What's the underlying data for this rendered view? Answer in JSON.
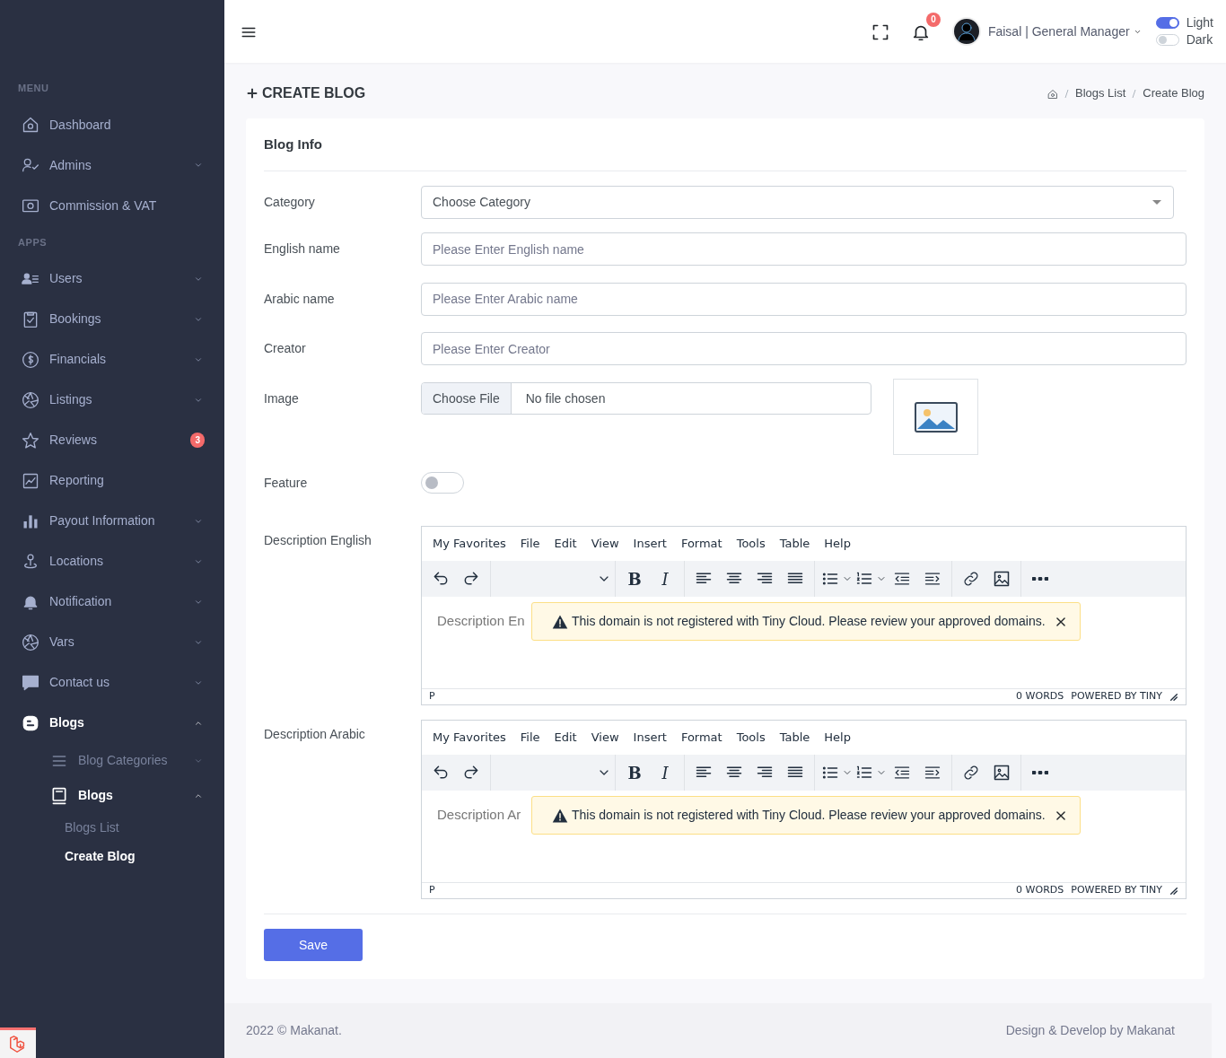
{
  "sidebar": {
    "sections": [
      {
        "title": "MENU",
        "items": [
          {
            "label": "Dashboard",
            "kind": "link",
            "selected": false
          },
          {
            "label": "Admins",
            "kind": "dropdown",
            "expanded": false,
            "selected": false
          },
          {
            "label": "Commission & VAT",
            "kind": "link",
            "selected": false
          }
        ]
      },
      {
        "title": "APPS",
        "items": [
          {
            "label": "Users",
            "kind": "dropdown",
            "expanded": false,
            "selected": false
          },
          {
            "label": "Bookings",
            "kind": "dropdown",
            "expanded": false,
            "selected": false
          },
          {
            "label": "Financials",
            "kind": "dropdown",
            "expanded": false,
            "selected": false
          },
          {
            "label": "Listings",
            "kind": "dropdown",
            "expanded": false,
            "selected": false
          },
          {
            "label": "Reviews",
            "kind": "link",
            "badge": "3",
            "selected": false
          },
          {
            "label": "Reporting",
            "kind": "link",
            "selected": false
          },
          {
            "label": "Payout Information",
            "kind": "dropdown",
            "expanded": false,
            "selected": false
          },
          {
            "label": "Locations",
            "kind": "dropdown",
            "expanded": false,
            "selected": false
          },
          {
            "label": "Notification",
            "kind": "dropdown",
            "expanded": false,
            "selected": false
          },
          {
            "label": "Vars",
            "kind": "dropdown",
            "expanded": false,
            "selected": false
          },
          {
            "label": "Contact us",
            "kind": "dropdown",
            "expanded": false,
            "selected": false
          },
          {
            "label": "Blogs",
            "kind": "dropdown",
            "expanded": true,
            "selected": true,
            "children": [
              {
                "label": "Blog Categories",
                "kind": "dropdown",
                "expanded": false,
                "selected": false
              },
              {
                "label": "Blogs",
                "kind": "dropdown",
                "expanded": true,
                "selected": true,
                "children": [
                  {
                    "label": "Blogs List",
                    "kind": "link",
                    "selected": false
                  },
                  {
                    "label": "Create Blog",
                    "kind": "link",
                    "selected": true
                  }
                ]
              }
            ]
          }
        ]
      }
    ]
  },
  "topbar": {
    "notification_count": "0",
    "user": "Faisal | General Manager",
    "theme": [
      {
        "label": "Light",
        "on": true
      },
      {
        "label": "Dark",
        "on": false
      }
    ]
  },
  "page": {
    "title": "CREATE BLOG",
    "breadcrumb": [
      "Blogs List",
      "Create Blog"
    ]
  },
  "form": {
    "title": "Blog Info",
    "fields": [
      {
        "kind": "select",
        "label": "Category",
        "value": "Choose Category"
      },
      {
        "kind": "text",
        "label": "English name",
        "placeholder": "Please Enter English name"
      },
      {
        "kind": "text",
        "label": "Arabic name",
        "placeholder": "Please Enter Arabic name"
      },
      {
        "kind": "text",
        "label": "Creator",
        "placeholder": "Please Enter Creator"
      },
      {
        "kind": "file",
        "label": "Image",
        "button": "Choose File",
        "value": "No file chosen"
      },
      {
        "kind": "toggle",
        "label": "Feature",
        "on": false
      },
      {
        "kind": "editor",
        "label": "Description English",
        "menu": [
          "My Favorites",
          "File",
          "Edit",
          "View",
          "Insert",
          "Format",
          "Tools",
          "Table",
          "Help"
        ],
        "format_buttons": [
          "B",
          "I"
        ],
        "placeholder": "Description En",
        "notice": "This domain is not registered with Tiny Cloud. Please review your approved domains.",
        "path": "P",
        "words": "0 WORDS",
        "brand": "POWERED BY TINY"
      },
      {
        "kind": "editor",
        "label": "Description Arabic",
        "menu": [
          "My Favorites",
          "File",
          "Edit",
          "View",
          "Insert",
          "Format",
          "Tools",
          "Table",
          "Help"
        ],
        "format_buttons": [
          "B",
          "I"
        ],
        "placeholder": "Description Ar",
        "notice": "This domain is not registered with Tiny Cloud. Please review your approved domains.",
        "path": "P",
        "words": "0 WORDS",
        "brand": "POWERED BY TINY"
      }
    ],
    "submit": "Save"
  },
  "footer": {
    "left": "2022 © Makanat.",
    "right": "Design & Develop by Makanat"
  }
}
